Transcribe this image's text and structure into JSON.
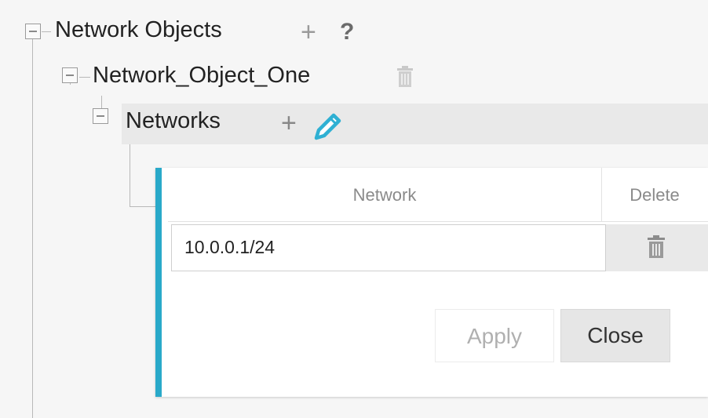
{
  "tree": {
    "root": {
      "label": "Network Objects",
      "icons": [
        "minus-box-icon",
        "plus-icon",
        "help-icon"
      ],
      "help_glyph": "?"
    },
    "child": {
      "label": "Network_Object_One",
      "icons": [
        "minus-box-icon",
        "trash-icon"
      ]
    },
    "grandchild": {
      "label": "Networks",
      "icons": [
        "minus-box-icon",
        "plus-icon",
        "pencil-icon"
      ]
    },
    "plus_glyph": "+"
  },
  "table": {
    "headers": {
      "network": "Network",
      "delete": "Delete"
    },
    "rows": [
      {
        "network": "10.0.0.1/24"
      }
    ]
  },
  "buttons": {
    "apply": "Apply",
    "close": "Close"
  },
  "colors": {
    "accent": "#29a9c9",
    "pencil": "#2fb0d3"
  }
}
